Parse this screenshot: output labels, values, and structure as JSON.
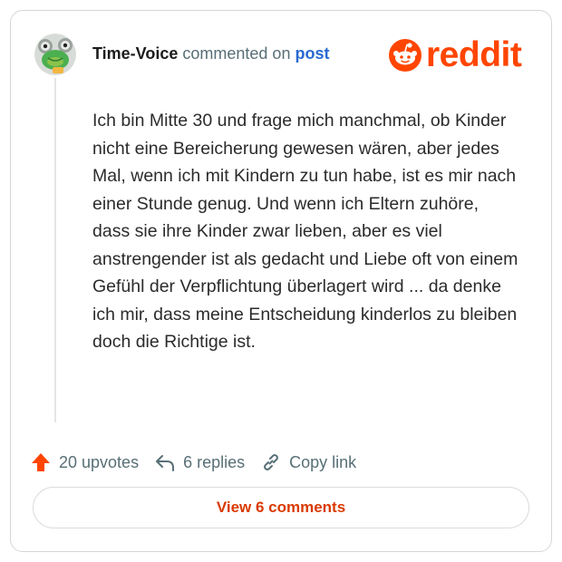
{
  "comment": {
    "username": "Time-Voice",
    "action_text": "commented on",
    "post_link": "post",
    "body": "Ich bin Mitte 30 und frage mich manchmal, ob Kinder nicht eine Bereicherung gewesen wären, aber jedes Mal, wenn ich mit Kindern zu tun habe, ist es mir nach einer Stunde genug. Und wenn ich Eltern zuhöre, dass sie ihre Kinder zwar lieben, aber es viel anstrengender ist als gedacht und Liebe oft von einem Gefühl der Verpflichtung überlagert wird ... da denke ich mir, dass meine Entscheidung kinderlos zu bleiben doch die Richtige ist."
  },
  "logo": {
    "wordmark": "reddit",
    "icon": "reddit-snoo-icon"
  },
  "actions": {
    "upvotes_label": "20 upvotes",
    "replies_label": "6 replies",
    "copy_link_label": "Copy link"
  },
  "view_comments_label": "View 6 comments",
  "colors": {
    "brand": "#ff4500",
    "link": "#2a6ad1",
    "muted": "#576f76",
    "button_text": "#d93a00"
  }
}
